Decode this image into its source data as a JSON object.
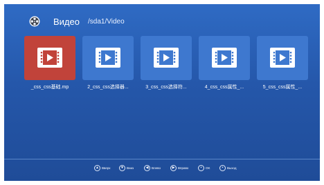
{
  "header": {
    "title": "Видео",
    "path": "/sda1/Video",
    "icon": "film-reel-icon"
  },
  "files": [
    {
      "name": "_css_css基础.mp",
      "icon": "video-file-icon",
      "selected": true
    },
    {
      "name": "2_css_css选择器...",
      "icon": "video-file-icon",
      "selected": false
    },
    {
      "name": "3_css_css选择符...",
      "icon": "video-file-icon",
      "selected": false
    },
    {
      "name": "4_css_css属性_...",
      "icon": "video-file-icon",
      "selected": false
    },
    {
      "name": "5_css_css属性_...",
      "icon": "video-file-icon",
      "selected": false
    }
  ],
  "footer": {
    "hints": [
      {
        "label": "Вверх",
        "icon": "arrow-up-icon"
      },
      {
        "label": "Вниз",
        "icon": "arrow-down-icon"
      },
      {
        "label": "Влево",
        "icon": "arrow-left-icon"
      },
      {
        "label": "Вправо",
        "icon": "arrow-right-icon"
      },
      {
        "label": "OK",
        "icon": "ok-icon"
      },
      {
        "label": "Выход",
        "icon": "exit-icon"
      }
    ]
  },
  "colors": {
    "background": "#2557aa",
    "tile": "#3e78cf",
    "selected_tile": "#c1433a"
  }
}
